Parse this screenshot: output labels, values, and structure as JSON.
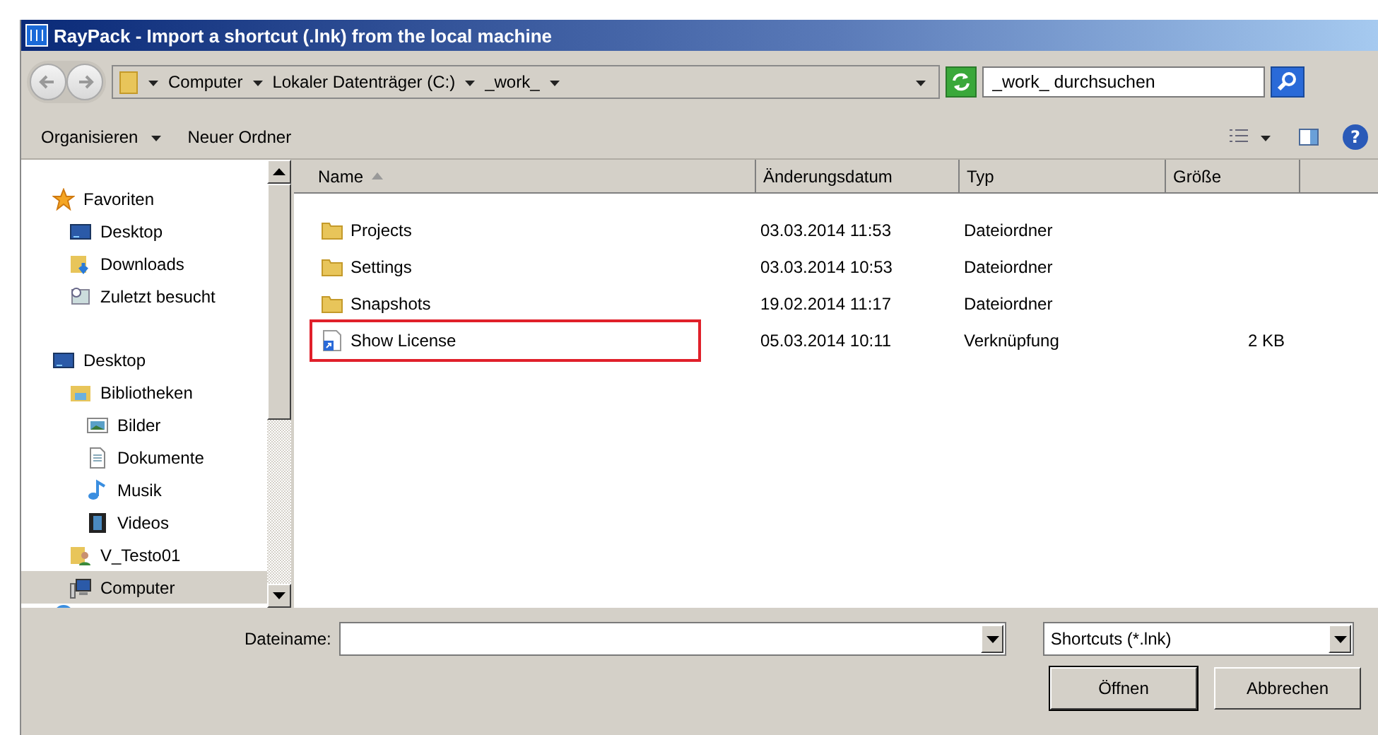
{
  "window": {
    "title": "RayPack - Import a shortcut (.lnk) from the local machine"
  },
  "address_bar": {
    "crumbs": [
      "Computer",
      "Lokaler Datenträger (C:)",
      "_work_"
    ]
  },
  "search": {
    "placeholder": "_work_ durchsuchen"
  },
  "toolbar": {
    "items": [
      "Organisieren",
      "Neuer Ordner"
    ]
  },
  "sidebar": {
    "items": [
      {
        "label": "Favoriten",
        "selected": false,
        "children": [
          {
            "label": "Desktop",
            "selected": false
          },
          {
            "label": "Downloads",
            "selected": false
          },
          {
            "label": "Zuletzt besucht",
            "selected": false
          }
        ]
      },
      {
        "label": "Desktop",
        "selected": false,
        "children": [
          {
            "label": "Bibliotheken",
            "selected": false,
            "children": [
              {
                "label": "Bilder",
                "selected": false
              },
              {
                "label": "Dokumente",
                "selected": false
              },
              {
                "label": "Musik",
                "selected": false
              },
              {
                "label": "Videos",
                "selected": false
              }
            ]
          },
          {
            "label": "V_Testo01",
            "selected": false
          },
          {
            "label": "Computer",
            "selected": true
          }
        ]
      }
    ]
  },
  "table": {
    "columns": [
      {
        "label": "Name",
        "sorted": true
      },
      {
        "label": "Änderungsdatum",
        "sorted": false
      },
      {
        "label": "Typ",
        "sorted": false
      },
      {
        "label": "Größe",
        "sorted": false
      }
    ],
    "rows": [
      {
        "kind": "folder",
        "name": "Projects",
        "date": "03.03.2014 11:53",
        "type": "Dateiordner",
        "highlighted": false
      },
      {
        "kind": "folder",
        "name": "Settings",
        "date": "03.03.2014 10:53",
        "type": "Dateiordner",
        "highlighted": false
      },
      {
        "kind": "folder",
        "name": "Snapshots",
        "date": "19.02.2014 11:17",
        "type": "Dateiordner",
        "highlighted": false
      },
      {
        "kind": "shortcut",
        "name": "Show License",
        "date": "05.03.2014 10:11",
        "type": "Verknüpfung",
        "size": "2 KB",
        "highlighted": true
      }
    ]
  },
  "file_name": {
    "label": "Dateiname:"
  },
  "file_type": {
    "value": "Shortcuts (*.lnk)"
  },
  "help_button": {
    "label": "?"
  },
  "buttons": [
    "Öffnen",
    "Abbrechen"
  ]
}
